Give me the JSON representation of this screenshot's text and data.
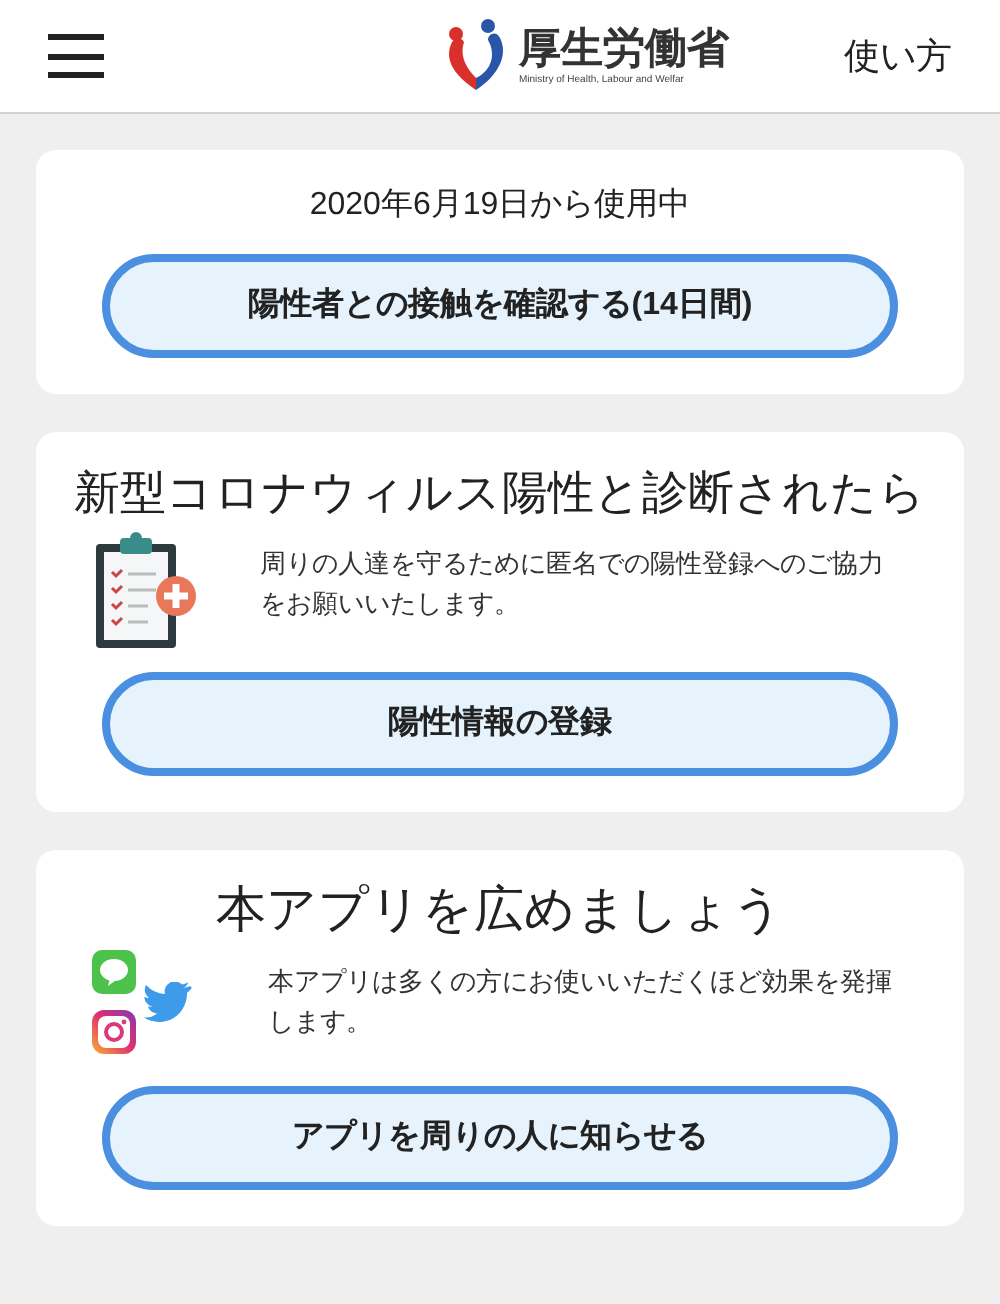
{
  "header": {
    "logo_title": "厚生労働省",
    "logo_subtitle": "Ministry of Health, Labour and Welfar",
    "help_link": "使い方"
  },
  "cards": [
    {
      "kind": "status",
      "caption": "2020年6月19日から使用中",
      "button": "陽性者との接触を確認する(14日間)"
    },
    {
      "kind": "report",
      "title": "新型コロナウィルス陽性と診断されたら",
      "body": "周りの人達を守るために匿名での陽性登録へのご協力をお願いいたします。",
      "button": "陽性情報の登録"
    },
    {
      "kind": "share",
      "title": "本アプリを広めましょう",
      "body": "本アプリは多くの方にお使いいただくほど効果を発揮します。",
      "button": "アプリを周りの人に知らせる"
    }
  ]
}
